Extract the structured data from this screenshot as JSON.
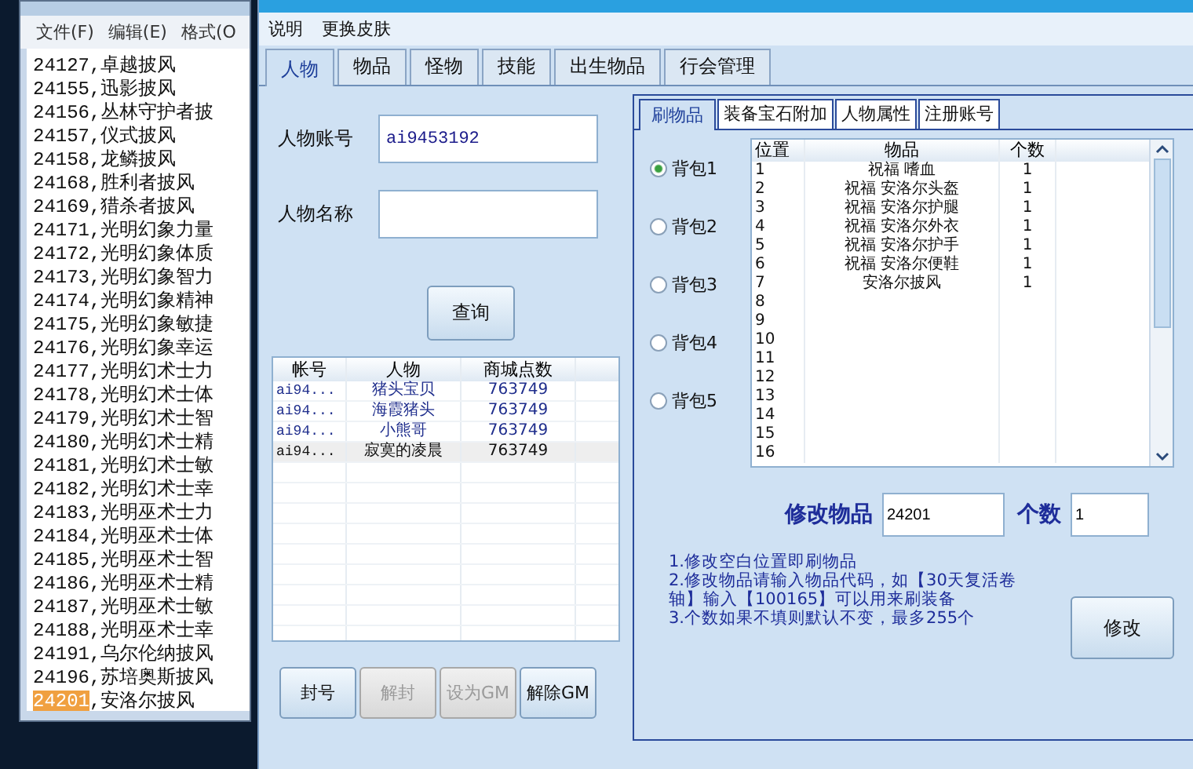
{
  "notepad": {
    "menu": [
      "文件(F)",
      "编辑(E)",
      "格式(O"
    ],
    "lines": [
      {
        "text": "24127,卓越披风"
      },
      {
        "text": "24155,迅影披风"
      },
      {
        "text": "24156,丛林守护者披"
      },
      {
        "text": "24157,仪式披风"
      },
      {
        "text": "24158,龙鳞披风"
      },
      {
        "text": "24168,胜利者披风"
      },
      {
        "text": "24169,猎杀者披风"
      },
      {
        "text": "24171,光明幻象力量"
      },
      {
        "text": "24172,光明幻象体质"
      },
      {
        "text": "24173,光明幻象智力"
      },
      {
        "text": "24174,光明幻象精神"
      },
      {
        "text": "24175,光明幻象敏捷"
      },
      {
        "text": "24176,光明幻象幸运"
      },
      {
        "text": "24177,光明幻术士力"
      },
      {
        "text": "24178,光明幻术士体"
      },
      {
        "text": "24179,光明幻术士智"
      },
      {
        "text": "24180,光明幻术士精"
      },
      {
        "text": "24181,光明幻术士敏"
      },
      {
        "text": "24182,光明幻术士幸"
      },
      {
        "text": "24183,光明巫术士力"
      },
      {
        "text": "24184,光明巫术士体"
      },
      {
        "text": "24185,光明巫术士智"
      },
      {
        "text": "24186,光明巫术士精"
      },
      {
        "text": "24187,光明巫术士敏"
      },
      {
        "text": "24188,光明巫术士幸"
      },
      {
        "text": "24191,乌尔伦纳披风"
      },
      {
        "text": "24196,苏培奥斯披风"
      },
      {
        "highlight": "24201",
        "text": ",安洛尔披风"
      }
    ]
  },
  "menu": [
    "说明",
    "更换皮肤"
  ],
  "tabs": [
    {
      "label": "人物",
      "selected": true
    },
    {
      "label": "物品",
      "selected": false
    },
    {
      "label": "怪物",
      "selected": false
    },
    {
      "label": "技能",
      "selected": false
    },
    {
      "label": "出生物品",
      "selected": false
    },
    {
      "label": "行会管理",
      "selected": false
    }
  ],
  "account_field": {
    "label": "人物账号",
    "value": "ai9453192"
  },
  "name_field": {
    "label": "人物名称"
  },
  "query_button": "查询",
  "players": {
    "columns": [
      "帐号",
      "人物",
      "商城点数"
    ],
    "rows": [
      {
        "account": "ai94...",
        "name": "猪头宝贝",
        "points": "763749",
        "selected": false
      },
      {
        "account": "ai94...",
        "name": "海霞猪头",
        "points": "763749",
        "selected": false
      },
      {
        "account": "ai94...",
        "name": "小熊哥",
        "points": "763749",
        "selected": false
      },
      {
        "account": "ai94...",
        "name": "寂寞的凌晨",
        "points": "763749",
        "selected": true
      }
    ]
  },
  "actions": [
    {
      "label": "封号",
      "disabled": false
    },
    {
      "label": "解封",
      "disabled": true
    },
    {
      "label": "设为GM",
      "disabled": true
    },
    {
      "label": "解除GM",
      "disabled": false
    }
  ],
  "subtabs": [
    {
      "label": "刷物品",
      "selected": true
    },
    {
      "label": "装备宝石附加",
      "selected": false
    },
    {
      "label": "人物属性",
      "selected": false
    },
    {
      "label": "注册账号",
      "selected": false
    }
  ],
  "bags": [
    {
      "label": "背包1",
      "selected": true
    },
    {
      "label": "背包2",
      "selected": false
    },
    {
      "label": "背包3",
      "selected": false
    },
    {
      "label": "背包4",
      "selected": false
    },
    {
      "label": "背包5",
      "selected": false
    }
  ],
  "items": {
    "columns": [
      "位置",
      "物品",
      "个数"
    ],
    "rows": [
      [
        "1",
        "祝福 嗜血",
        "1"
      ],
      [
        "2",
        "祝福 安洛尔头盔",
        "1"
      ],
      [
        "3",
        "祝福 安洛尔护腿",
        "1"
      ],
      [
        "4",
        "祝福 安洛尔外衣",
        "1"
      ],
      [
        "5",
        "祝福 安洛尔护手",
        "1"
      ],
      [
        "6",
        "祝福 安洛尔便鞋",
        "1"
      ],
      [
        "7",
        "安洛尔披风",
        "1"
      ],
      [
        "8"
      ],
      [
        "9"
      ],
      [
        "10"
      ],
      [
        "11"
      ],
      [
        "12"
      ],
      [
        "13"
      ],
      [
        "14"
      ],
      [
        "15"
      ],
      [
        "16"
      ]
    ]
  },
  "edit_item": {
    "label": "修改物品",
    "value": "24201"
  },
  "edit_count": {
    "label": "个数",
    "value": "1"
  },
  "notes": [
    "1.修改空白位置即刷物品",
    "2.修改物品请输入物品代码，如【30天复活卷轴】输入【100165】可以用来刷装备",
    "3.个数如果不填则默认不变，最多255个"
  ],
  "modify_button": "修改"
}
